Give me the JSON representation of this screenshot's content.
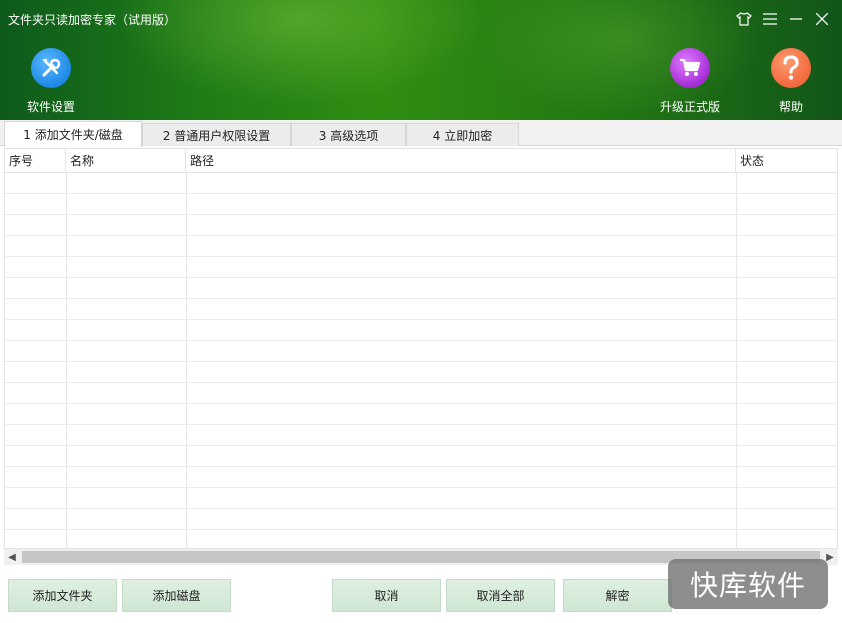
{
  "window": {
    "title": "文件夹只读加密专家（试用版）",
    "controls": [
      {
        "icon": "shirt-icon"
      },
      {
        "icon": "menu-icon"
      },
      {
        "icon": "minimize-icon"
      },
      {
        "icon": "close-icon"
      }
    ]
  },
  "toolbar": {
    "settings": {
      "label": "软件设置",
      "icon": "wrench-screwdriver-icon"
    },
    "upgrade": {
      "label": "升级正式版",
      "icon": "cart-icon"
    },
    "help": {
      "label": "帮助",
      "icon": "question-icon"
    }
  },
  "tabs": [
    {
      "label": "1 添加文件夹/磁盘",
      "active": true
    },
    {
      "label": "2 普通用户权限设置",
      "active": false
    },
    {
      "label": "3 高级选项",
      "active": false
    },
    {
      "label": "4 立即加密",
      "active": false
    }
  ],
  "table": {
    "columns": [
      "序号",
      "名称",
      "路径",
      "状态"
    ],
    "rows": []
  },
  "buttons": {
    "add_folder": "添加文件夹",
    "add_disk": "添加磁盘",
    "cancel": "取消",
    "cancel_all": "取消全部",
    "decrypt": "解密"
  },
  "watermark": {
    "text": "快库软件"
  },
  "colors": {
    "header_green": "#1f7d16",
    "button_bg": "#d8ecdb",
    "settings_icon": "#1e88e5",
    "upgrade_icon": "#a52cd6",
    "help_icon": "#f2683c"
  }
}
